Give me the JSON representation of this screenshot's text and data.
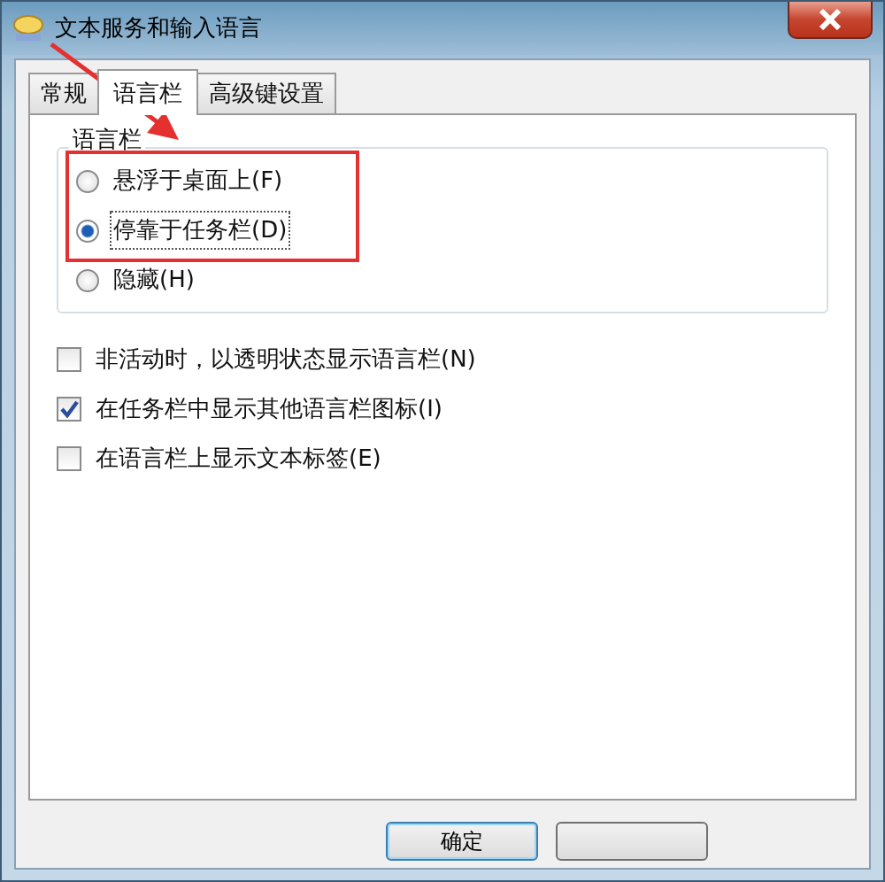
{
  "window": {
    "title": "文本服务和输入语言"
  },
  "tabs": [
    {
      "label": "常规",
      "selected": false
    },
    {
      "label": "语言栏",
      "selected": true
    },
    {
      "label": "高级键设置",
      "selected": false
    }
  ],
  "language_bar_group": {
    "title": "语言栏",
    "options": [
      {
        "label": "悬浮于桌面上(F)",
        "selected": false,
        "focused": false
      },
      {
        "label": "停靠于任务栏(D)",
        "selected": true,
        "focused": true
      },
      {
        "label": "隐藏(H)",
        "selected": false,
        "focused": false
      }
    ]
  },
  "checkboxes": [
    {
      "label": "非活动时，以透明状态显示语言栏(N)",
      "checked": false
    },
    {
      "label": "在任务栏中显示其他语言栏图标(I)",
      "checked": true
    },
    {
      "label": "在语言栏上显示文本标签(E)",
      "checked": false
    }
  ],
  "buttons": [
    {
      "label": "确定",
      "kind": "default"
    },
    {
      "kind": "plain"
    }
  ]
}
